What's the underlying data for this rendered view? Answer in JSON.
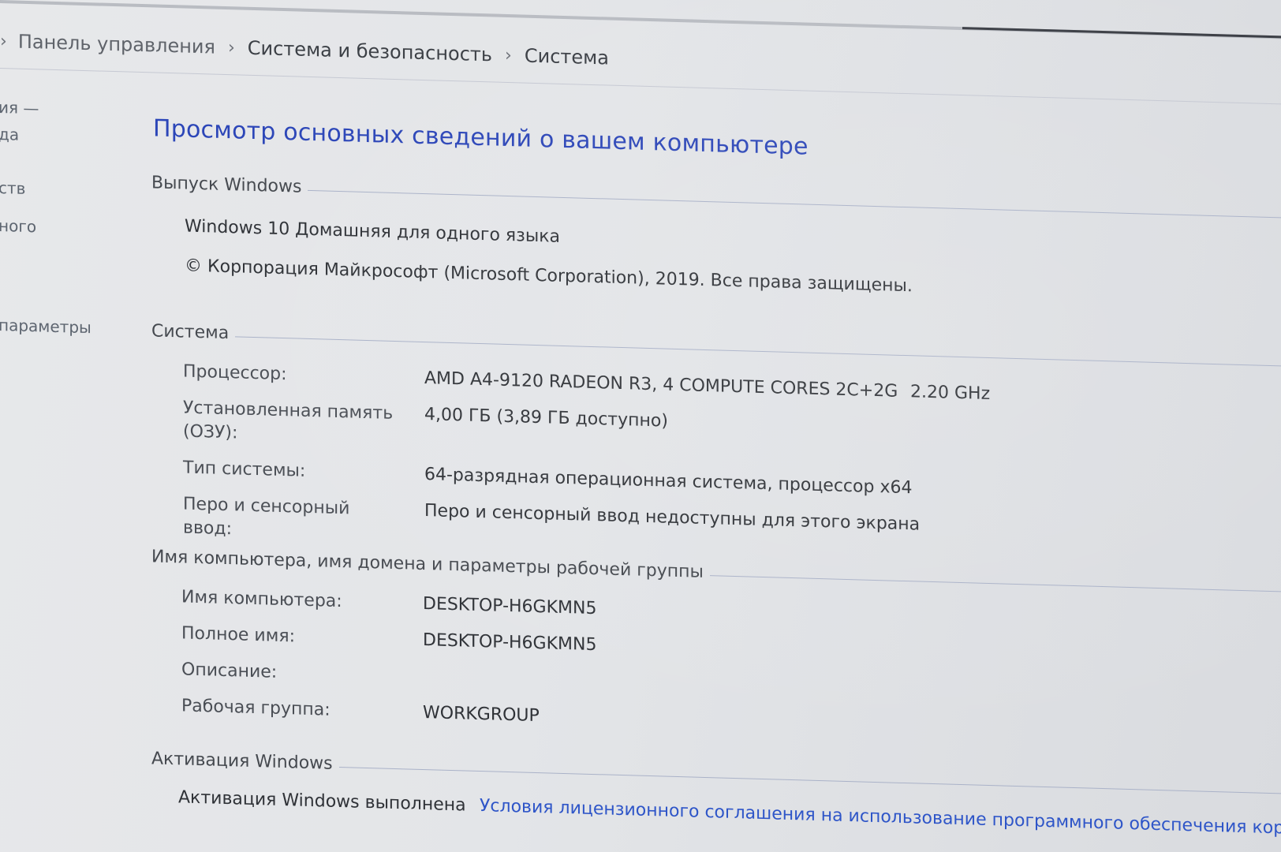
{
  "breadcrumb": {
    "items": [
      {
        "label": "Панель управления"
      },
      {
        "label": "Система и безопасность"
      },
      {
        "label": "Система"
      }
    ]
  },
  "sidebar": {
    "fragments": [
      "ия —",
      "да",
      "ств",
      "ного",
      "параметры"
    ]
  },
  "page": {
    "title": "Просмотр основных сведений о вашем компьютере"
  },
  "edition": {
    "header": "Выпуск Windows",
    "name": "Windows 10 Домашняя для одного языка",
    "copyright": "© Корпорация Майкрософт (Microsoft Corporation), 2019. Все права защищены."
  },
  "system": {
    "header": "Система",
    "rows": [
      {
        "label": "Процессор:",
        "value": "AMD A4-9120 RADEON R3, 4 COMPUTE CORES 2C+2G",
        "extra": "2.20 GHz"
      },
      {
        "label": "Установленная память (ОЗУ):",
        "value": "4,00 ГБ (3,89 ГБ доступно)"
      },
      {
        "label": "Тип системы:",
        "value": "64-разрядная операционная система, процессор x64"
      },
      {
        "label": "Перо и сенсорный ввод:",
        "value": "Перо и сенсорный ввод недоступны для этого экрана"
      }
    ]
  },
  "computer": {
    "header": "Имя компьютера, имя домена и параметры рабочей группы",
    "rows": [
      {
        "label": "Имя компьютера:",
        "value": "DESKTOP-H6GKMN5"
      },
      {
        "label": "Полное имя:",
        "value": "DESKTOP-H6GKMN5"
      },
      {
        "label": "Описание:",
        "value": ""
      },
      {
        "label": "Рабочая группа:",
        "value": "WORKGROUP"
      }
    ]
  },
  "activation": {
    "header": "Активация Windows",
    "status": "Активация Windows выполнена",
    "license_link": "Условия лицензионного соглашения на использование программного обеспечения корп"
  },
  "colors": {
    "title_blue": "#2c46b8",
    "link_blue": "#2e55c8",
    "background": "#e3e5e8"
  }
}
